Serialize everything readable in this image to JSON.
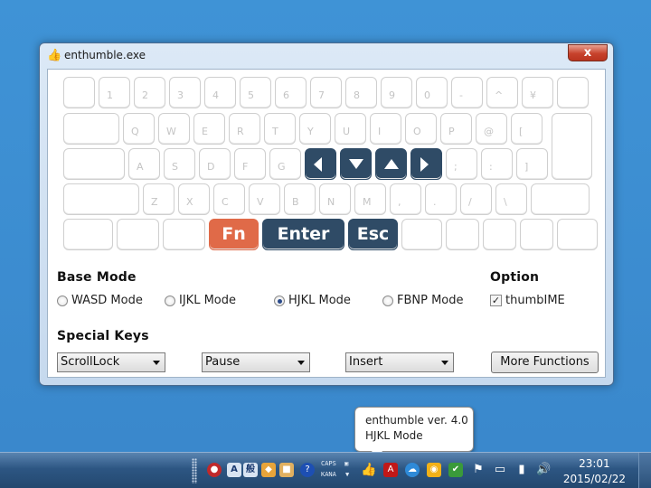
{
  "window": {
    "title": "enthumble.exe",
    "close_label": "x"
  },
  "keyboard": {
    "row1": [
      "",
      "1",
      "2",
      "3",
      "4",
      "5",
      "6",
      "7",
      "8",
      "9",
      "0",
      "-",
      "^",
      "¥",
      ""
    ],
    "row2": [
      "",
      "Q",
      "W",
      "E",
      "R",
      "T",
      "Y",
      "U",
      "I",
      "O",
      "P",
      "@",
      "["
    ],
    "row3": [
      "",
      "A",
      "S",
      "D",
      "F",
      "G",
      "",
      "",
      "",
      "",
      ";",
      ":",
      "]"
    ],
    "row4": [
      "",
      "Z",
      "X",
      "C",
      "V",
      "B",
      "N",
      "M",
      ",",
      ".",
      "/",
      "\\",
      ""
    ],
    "row5": [
      "",
      "",
      "",
      "Fn",
      "Enter",
      "Esc",
      "",
      "",
      "",
      "",
      ""
    ],
    "arrows": [
      "left-arrow",
      "down-arrow",
      "up-arrow",
      "right-arrow"
    ],
    "accent_dark": "#2f4b66",
    "accent_orange": "#e06a48"
  },
  "base_mode": {
    "heading": "Base Mode",
    "options": [
      "WASD Mode",
      "IJKL Mode",
      "HJKL Mode",
      "FBNP Mode"
    ],
    "selected": "HJKL Mode"
  },
  "option": {
    "heading": "Option",
    "thumbime_label": "thumbIME",
    "thumbime_checked": true
  },
  "special_keys": {
    "heading": "Special Keys",
    "select1": "ScrollLock",
    "select2": "Pause",
    "select3": "Insert",
    "more_button": "More Functions"
  },
  "tooltip": {
    "line1": "enthumble ver. 4.0",
    "line2": "HJKL Mode"
  },
  "taskbar": {
    "ime_a": "A",
    "ime_kan": "般",
    "caps": "CAPS",
    "kana": "KANA",
    "time": "23:01",
    "date": "2015/02/22"
  }
}
